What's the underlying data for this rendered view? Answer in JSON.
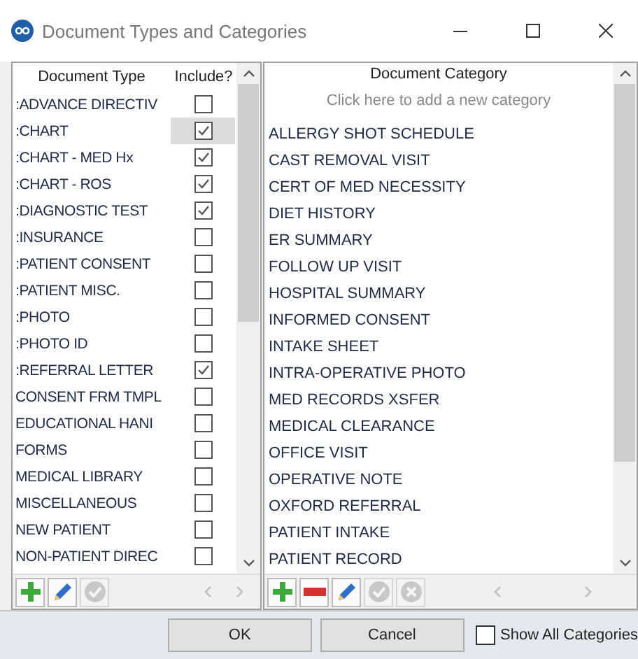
{
  "window": {
    "title": "Document Types and Categories"
  },
  "document_types": {
    "columns": [
      "Document Type",
      "Include?"
    ],
    "rows": [
      {
        "name": ":ADVANCE DIRECTIV",
        "include": false,
        "selected": false
      },
      {
        "name": ":CHART",
        "include": true,
        "selected": true
      },
      {
        "name": ":CHART - MED Hx",
        "include": true,
        "selected": false
      },
      {
        "name": ":CHART - ROS",
        "include": true,
        "selected": false
      },
      {
        "name": ":DIAGNOSTIC TEST",
        "include": true,
        "selected": false
      },
      {
        "name": ":INSURANCE",
        "include": false,
        "selected": false
      },
      {
        "name": ":PATIENT CONSENT",
        "include": false,
        "selected": false
      },
      {
        "name": ":PATIENT MISC.",
        "include": false,
        "selected": false
      },
      {
        "name": ":PHOTO",
        "include": false,
        "selected": false
      },
      {
        "name": ":PHOTO ID",
        "include": false,
        "selected": false
      },
      {
        "name": ":REFERRAL LETTER",
        "include": true,
        "selected": false
      },
      {
        "name": "CONSENT FRM TMPL",
        "include": false,
        "selected": false
      },
      {
        "name": "EDUCATIONAL HANI",
        "include": false,
        "selected": false
      },
      {
        "name": "FORMS",
        "include": false,
        "selected": false
      },
      {
        "name": "MEDICAL LIBRARY",
        "include": false,
        "selected": false
      },
      {
        "name": "MISCELLANEOUS",
        "include": false,
        "selected": false
      },
      {
        "name": "NEW PATIENT",
        "include": false,
        "selected": false
      },
      {
        "name": "NON-PATIENT DIREC",
        "include": false,
        "selected": false
      }
    ],
    "toolbar": [
      {
        "kind": "add",
        "disabled": false
      },
      {
        "kind": "edit",
        "disabled": false
      },
      {
        "kind": "confirm",
        "disabled": true
      }
    ]
  },
  "document_categories": {
    "column": "Document Category",
    "placeholder": "Click here to add a new category",
    "rows": [
      "ALLERGY SHOT SCHEDULE",
      "CAST REMOVAL VISIT",
      "CERT OF MED NECESSITY",
      "DIET HISTORY",
      "ER SUMMARY",
      "FOLLOW UP VISIT",
      "HOSPITAL SUMMARY",
      "INFORMED CONSENT",
      "INTAKE SHEET",
      "INTRA-OPERATIVE PHOTO",
      "MED RECORDS XSFER",
      "MEDICAL CLEARANCE",
      "OFFICE VISIT",
      "OPERATIVE NOTE",
      "OXFORD REFERRAL",
      "PATIENT INTAKE",
      "PATIENT RECORD"
    ],
    "toolbar": [
      {
        "kind": "add",
        "disabled": false
      },
      {
        "kind": "remove",
        "disabled": false
      },
      {
        "kind": "edit",
        "disabled": false
      },
      {
        "kind": "confirm",
        "disabled": true
      },
      {
        "kind": "cancel",
        "disabled": true
      }
    ]
  },
  "buttons": [
    "OK",
    "Cancel"
  ],
  "show_all": {
    "label": "Show All Categories",
    "checked": false
  }
}
